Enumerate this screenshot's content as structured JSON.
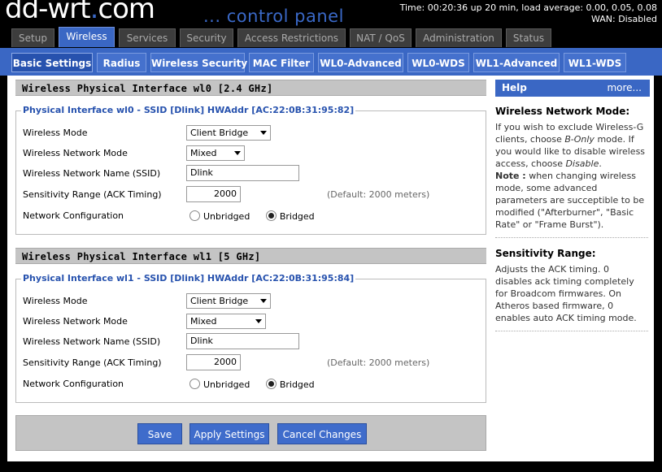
{
  "header": {
    "logo_main": "dd-wrt",
    "logo_dot": ".",
    "logo_com": "com",
    "subtitle": "... control panel",
    "status_time": "Time: 00:20:36 up 20 min, load average: 0.00, 0.05, 0.08",
    "status_wan": "WAN: Disabled"
  },
  "main_tabs": [
    "Setup",
    "Wireless",
    "Services",
    "Security",
    "Access Restrictions",
    "NAT / QoS",
    "Administration",
    "Status"
  ],
  "main_tab_active": "Wireless",
  "sub_tabs": [
    "Basic Settings",
    "Radius",
    "Wireless Security",
    "MAC Filter",
    "WL0-Advanced",
    "WL0-WDS",
    "WL1-Advanced",
    "WL1-WDS"
  ],
  "sub_tab_active": "Basic Settings",
  "sections": [
    {
      "title": "Wireless Physical Interface wl0 [2.4 GHz]",
      "legend": "Physical Interface wl0 - SSID [Dlink] HWAddr [AC:22:0B:31:95:82]",
      "labels": {
        "mode": "Wireless Mode",
        "network_mode": "Wireless Network Mode",
        "ssid": "Wireless Network Name (SSID)",
        "sensitivity": "Sensitivity Range (ACK Timing)",
        "netconfig": "Network Configuration"
      },
      "mode_value": "Client Bridge",
      "network_mode_value": "Mixed",
      "ssid_value": "Dlink",
      "sensitivity_value": "2000",
      "sensitivity_default": "(Default: 2000 meters)",
      "netconfig_options": [
        "Unbridged",
        "Bridged"
      ],
      "netconfig_selected": "Bridged"
    },
    {
      "title": "Wireless Physical Interface wl1 [5 GHz]",
      "legend": "Physical Interface wl1 - SSID [Dlink] HWAddr [AC:22:0B:31:95:84]",
      "labels": {
        "mode": "Wireless Mode",
        "network_mode": "Wireless Network Mode",
        "ssid": "Wireless Network Name (SSID)",
        "sensitivity": "Sensitivity Range (ACK Timing)",
        "netconfig": "Network Configuration"
      },
      "mode_value": "Client Bridge",
      "network_mode_value": "Mixed",
      "ssid_value": "Dlink",
      "sensitivity_value": "2000",
      "sensitivity_default": "(Default: 2000 meters)",
      "netconfig_options": [
        "Unbridged",
        "Bridged"
      ],
      "netconfig_selected": "Bridged"
    }
  ],
  "buttons": {
    "save": "Save",
    "apply": "Apply Settings",
    "cancel": "Cancel Changes"
  },
  "help": {
    "title": "Help",
    "more": "more...",
    "topic1_title": "Wireless Network Mode:",
    "topic1_p1": "If you wish to exclude Wireless-G clients, choose ",
    "topic1_p1_em": "B-Only",
    "topic1_p1_tail": " mode. If you would like to disable wireless access, choose ",
    "topic1_p1_em2": "Disable",
    "topic1_p1_end": ".",
    "topic1_note_label": "Note :",
    "topic1_note": " when changing wireless mode, some advanced parameters are succeptible to be modified (\"Afterburner\", \"Basic Rate\" or \"Frame Burst\").",
    "topic2_title": "Sensitivity Range:",
    "topic2_text": "Adjusts the ACK timing. 0 disables ack timing completely for Broadcom firmwares. On Atheros based firmware, 0 enables auto ACK timing mode."
  },
  "colors": {
    "accent": "#3a67c4",
    "legend_text": "#2752ae",
    "section_header_bg": "#c4c4c4"
  }
}
